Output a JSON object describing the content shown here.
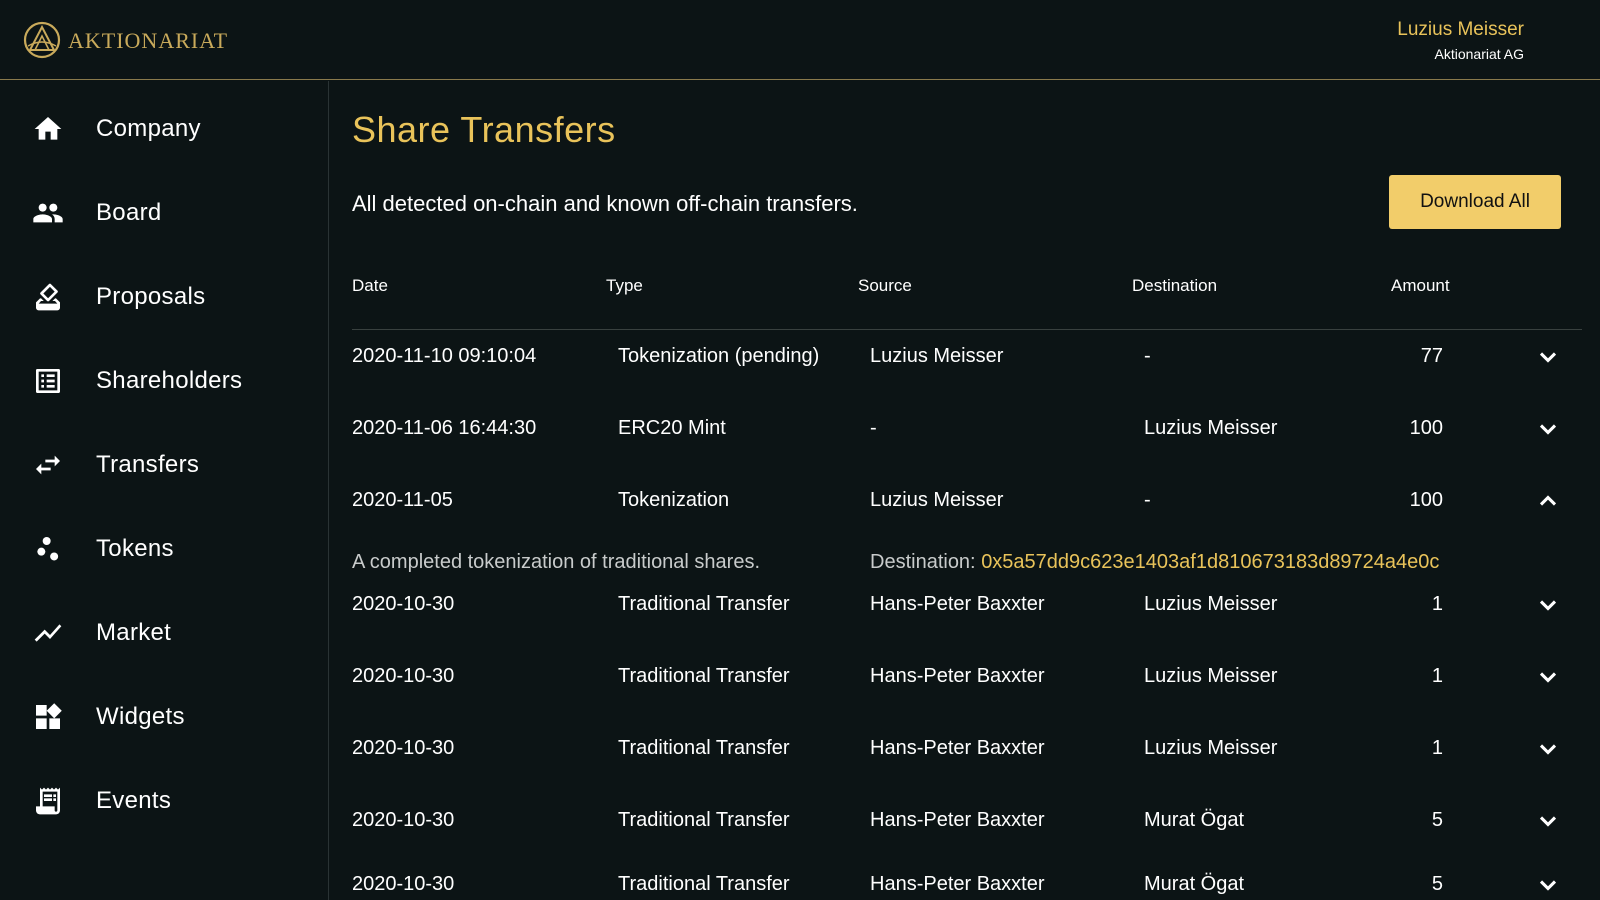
{
  "header": {
    "brand": "AKTIONARIAT",
    "user_name": "Luzius Meisser",
    "user_company": "Aktionariat AG"
  },
  "sidebar": {
    "items": [
      {
        "label": "Company",
        "icon": "home-icon"
      },
      {
        "label": "Board",
        "icon": "people-icon"
      },
      {
        "label": "Proposals",
        "icon": "ballot-icon"
      },
      {
        "label": "Shareholders",
        "icon": "list-icon"
      },
      {
        "label": "Transfers",
        "icon": "swap-arrows-icon"
      },
      {
        "label": "Tokens",
        "icon": "tokens-icon"
      },
      {
        "label": "Market",
        "icon": "trending-icon"
      },
      {
        "label": "Widgets",
        "icon": "widgets-icon"
      },
      {
        "label": "Events",
        "icon": "receipt-icon"
      }
    ]
  },
  "main": {
    "title": "Share Transfers",
    "subtitle": "All detected on-chain and known off-chain transfers.",
    "download_label": "Download All",
    "columns": {
      "date": "Date",
      "type": "Type",
      "source": "Source",
      "destination": "Destination",
      "amount": "Amount"
    },
    "rows": [
      {
        "date": "2020-11-10 09:10:04",
        "type": "Tokenization (pending)",
        "source": "Luzius Meisser",
        "destination": "-",
        "amount": "77",
        "expanded": false
      },
      {
        "date": "2020-11-06 16:44:30",
        "type": "ERC20 Mint",
        "source": "-",
        "destination": "Luzius Meisser",
        "amount": "100",
        "expanded": false
      },
      {
        "date": "2020-11-05",
        "type": "Tokenization",
        "source": "Luzius Meisser",
        "destination": "-",
        "amount": "100",
        "expanded": true
      },
      {
        "date": "2020-10-30",
        "type": "Traditional Transfer",
        "source": "Hans-Peter Baxxter",
        "destination": "Luzius Meisser",
        "amount": "1",
        "expanded": false
      },
      {
        "date": "2020-10-30",
        "type": "Traditional Transfer",
        "source": "Hans-Peter Baxxter",
        "destination": "Luzius Meisser",
        "amount": "1",
        "expanded": false
      },
      {
        "date": "2020-10-30",
        "type": "Traditional Transfer",
        "source": "Hans-Peter Baxxter",
        "destination": "Luzius Meisser",
        "amount": "1",
        "expanded": false
      },
      {
        "date": "2020-10-30",
        "type": "Traditional Transfer",
        "source": "Hans-Peter Baxxter",
        "destination": "Murat Ögat",
        "amount": "5",
        "expanded": false
      },
      {
        "date": "2020-10-30",
        "type": "Traditional Transfer",
        "source": "Hans-Peter Baxxter",
        "destination": "Murat Ögat",
        "amount": "5",
        "expanded": false
      }
    ],
    "expanded_detail": {
      "description": "A completed tokenization of traditional shares.",
      "destination_label": "Destination:",
      "destination_address": "0x5a57dd9c623e1403af1d810673183d89724a4e0c"
    }
  },
  "colors": {
    "background": "#0c1415",
    "accent_gold": "#e9c35a",
    "button_gold": "#f2cd6a",
    "logo_gold": "#c9aa5b"
  }
}
